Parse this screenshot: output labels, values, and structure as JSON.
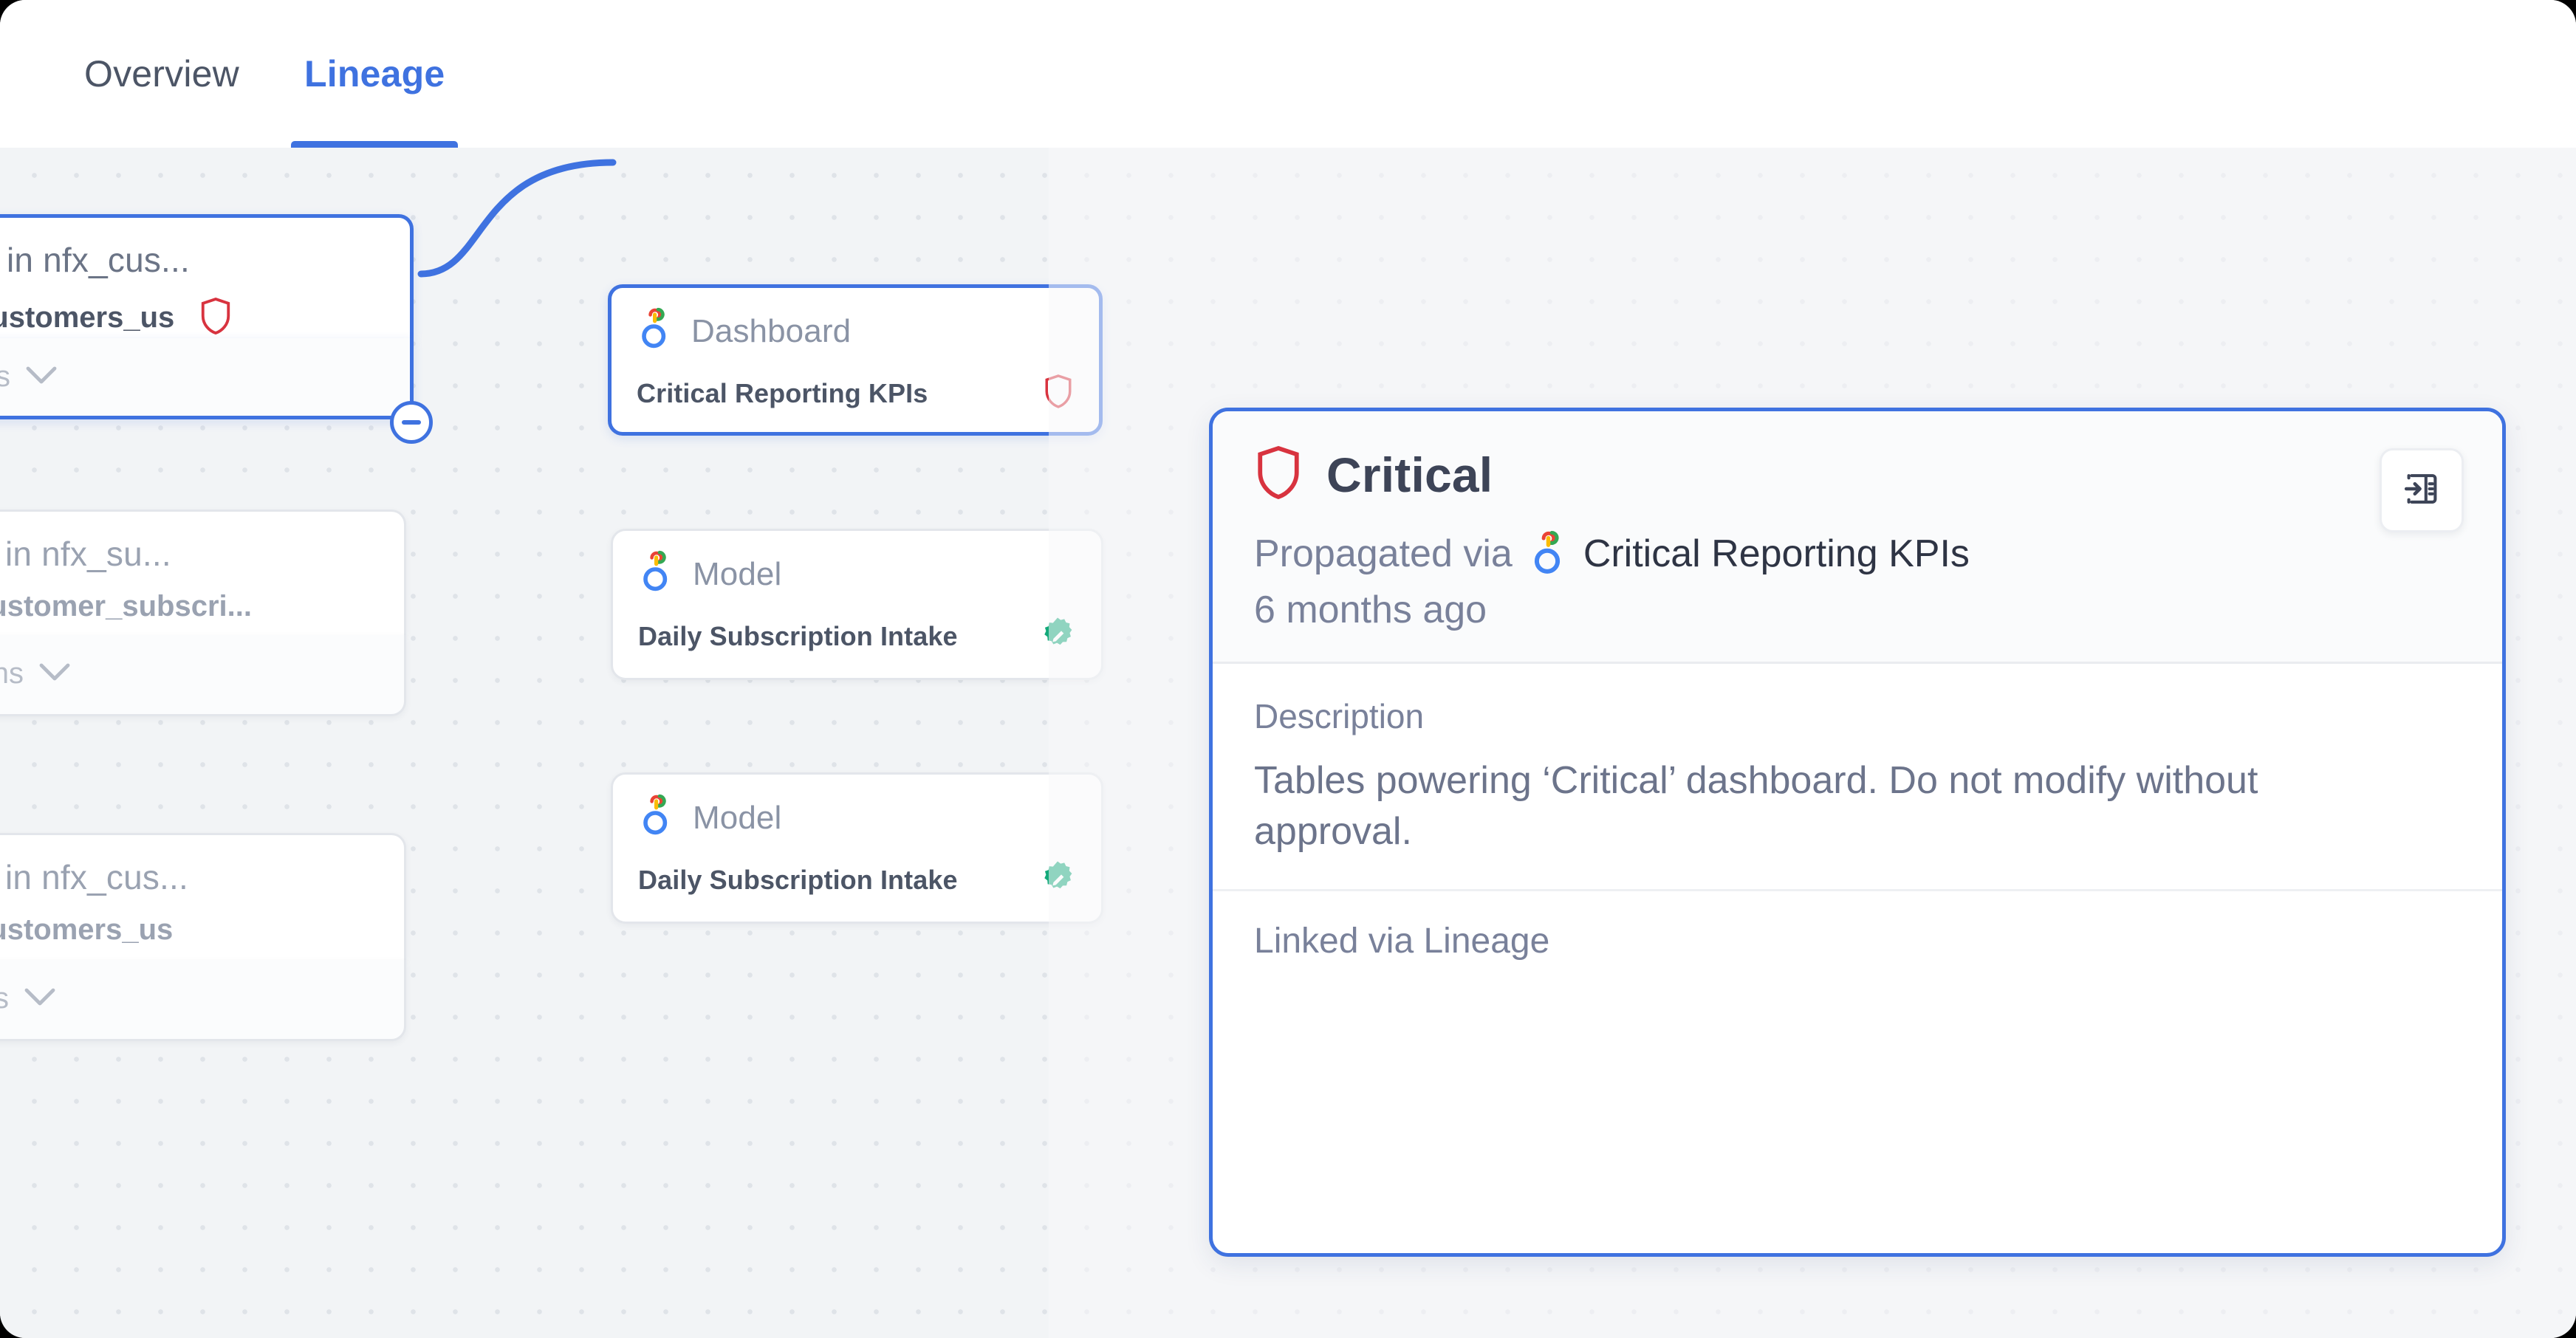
{
  "header": {
    "tabs": [
      {
        "label": "Overview",
        "active": false
      },
      {
        "label": "Lineage",
        "active": true
      }
    ]
  },
  "canvas": {
    "table_nodes": [
      {
        "title": "Table in nfx_cus...",
        "name": "flix_customers_us",
        "footer_label": "olumns",
        "shield": "shield-icon",
        "chevron": "chevron-down-icon",
        "selected": true
      },
      {
        "title": "Table in nfx_su...",
        "name": "flix_customer_subscri...",
        "footer_label": "columns",
        "chevron": "chevron-down-icon",
        "selected": false
      },
      {
        "title": "Table in nfx_cus...",
        "name": "flix_customers_us",
        "footer_label": "olumns",
        "chevron": "chevron-down-icon",
        "selected": false
      }
    ],
    "asset_nodes": [
      {
        "kind": "Dashboard",
        "name": "Critical Reporting KPIs",
        "icon": "looker-icon",
        "badge": "shield-icon",
        "selected": true
      },
      {
        "kind": "Model",
        "name": "Daily Subscription Intake",
        "icon": "looker-icon",
        "badge": "verified-pencil-icon",
        "selected": false
      },
      {
        "kind": "Model",
        "name": "Daily Subscription Intake",
        "icon": "looker-icon",
        "badge": "verified-pencil-icon",
        "selected": false
      }
    ],
    "collapse_handle": "minus-icon"
  },
  "panel": {
    "shield_icon": "shield-icon",
    "title": "Critical",
    "propagated_label": "Propagated via",
    "propagated_source": "Critical Reporting KPIs",
    "propagated_icon": "looker-icon",
    "timestamp": "6 months ago",
    "description_label": "Description",
    "description_text": "Tables powering ‘Critical’ dashboard. Do not modify without approval.",
    "footer_text": "Linked via Lineage",
    "open_button_icon": "open-in-panel-icon"
  },
  "colors": {
    "accent_blue": "#3f72e0",
    "critical_red": "#d8333f",
    "verified_green": "#13a97a",
    "canvas_bg": "#f2f4f6",
    "text_dark": "#3d4457",
    "text_muted": "#79819a"
  }
}
